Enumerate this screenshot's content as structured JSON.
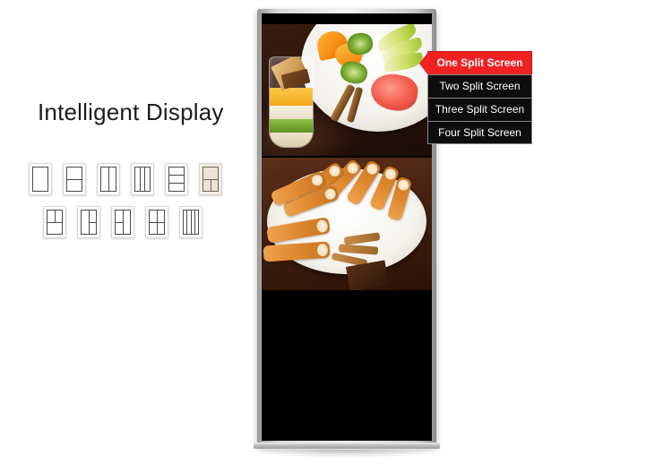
{
  "page": {
    "title": "Intelligent Display",
    "background_color": "#ffffff"
  },
  "layouts": {
    "selected_index": 5,
    "highlight_color": "#ece4d6",
    "items": [
      {
        "id": "layout-1-full",
        "label": "One Split Screen",
        "icon": "layout-single-icon"
      },
      {
        "id": "layout-2-rows",
        "label": "Two Split Screen",
        "icon": "layout-two-rows-icon"
      },
      {
        "id": "layout-2-cols",
        "label": "Two Split Screen",
        "icon": "layout-two-columns-icon"
      },
      {
        "id": "layout-3-cols",
        "label": "Three Split Screen",
        "icon": "layout-three-columns-icon"
      },
      {
        "id": "layout-3-rows",
        "label": "Three Split Screen",
        "icon": "layout-three-rows-icon"
      },
      {
        "id": "layout-top-two-bottom",
        "label": "Three Split Screen",
        "icon": "layout-top-bar-two-cells-icon"
      },
      {
        "id": "layout-two-top-one-bottom",
        "label": "Three Split Screen",
        "icon": "layout-two-top-one-bottom-icon"
      },
      {
        "id": "layout-left-full-right-two",
        "label": "Three Split Screen",
        "icon": "layout-left-full-right-split-icon"
      },
      {
        "id": "layout-left-two-right-full",
        "label": "Three Split Screen",
        "icon": "layout-left-split-right-full-icon"
      },
      {
        "id": "layout-quad",
        "label": "Four Split Screen",
        "icon": "layout-quad-grid-icon"
      },
      {
        "id": "layout-4-cols",
        "label": "Four Split Screen",
        "icon": "layout-four-columns-icon"
      }
    ]
  },
  "split_menu": {
    "active_index": 0,
    "active_color": "#ef2121",
    "item_background": "#0d0d0d",
    "items": [
      {
        "label": "One Split Screen"
      },
      {
        "label": "Two Split Screen"
      },
      {
        "label": "Three Split Screen"
      },
      {
        "label": "Four Split Screen"
      }
    ]
  },
  "kiosk": {
    "name": "digital-signage-kiosk",
    "bezel_color": "#c9c9c9",
    "screen_color": "#000000",
    "media": {
      "top": {
        "caption": "fruit platter with orange, kiwi, apple, grapefruit and parfait glass"
      },
      "bottom": {
        "caption": "swiss roll slices with cinnamon sticks on a white plate"
      }
    }
  }
}
